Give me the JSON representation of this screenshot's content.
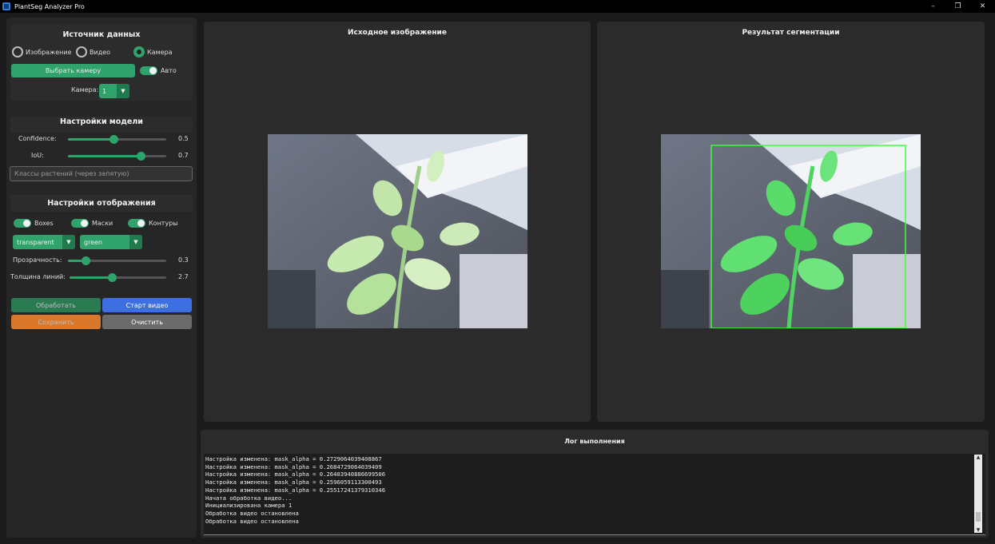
{
  "window": {
    "title": "PlantSeg Analyzer Pro",
    "minimize": "–",
    "restore": "❐",
    "close": "✕"
  },
  "source": {
    "title": "Источник данных",
    "radios": [
      {
        "label": "Изображение",
        "selected": false
      },
      {
        "label": "Видео",
        "selected": false
      },
      {
        "label": "Камера",
        "selected": true
      }
    ],
    "choose_camera_label": "Выбрать камеру",
    "auto_label": "Авто",
    "camera_label": "Камера:",
    "camera_value": "1"
  },
  "model": {
    "title": "Настройки модели",
    "confidence_label": "Confidence:",
    "confidence_value": "0.5",
    "iou_label": "IoU:",
    "iou_value": "0.7",
    "classes_placeholder": "Классы растений (через запятую)"
  },
  "display": {
    "title": "Настройки отображения",
    "toggles": [
      "Boxes",
      "Маски",
      "Контуры"
    ],
    "color1": "transparent",
    "color2": "green",
    "opacity_label": "Прозрачность:",
    "opacity_value": "0.3",
    "thickness_label": "Толщина линий:",
    "thickness_value": "2.7"
  },
  "actions": {
    "process": "Обработать",
    "start_video": "Старт видео",
    "save": "Сохранить",
    "clear": "Очистить"
  },
  "panels": {
    "source_title": "Исходное изображение",
    "result_title": "Результат сегментации"
  },
  "log": {
    "title": "Лог выполнения",
    "lines": [
      "Настройка изменена: mask_alpha = 0.2729064039408867",
      "Настройка изменена: mask_alpha = 0.2684729064039409",
      "Настройка изменена: mask_alpha = 0.26403940886699506",
      "Настройка изменена: mask_alpha = 0.2596059113300493",
      "Настройка изменена: mask_alpha = 0.25517241379310346",
      "Начата обработка видео...",
      "Инициализирована камера 1",
      "Обработка видео остановлена",
      "Обработка видео остановлена"
    ]
  },
  "colors": {
    "accent": "#2fa36b",
    "blue": "#3d6fe0",
    "orange": "#d9772b",
    "gray": "#6b6b6b"
  }
}
